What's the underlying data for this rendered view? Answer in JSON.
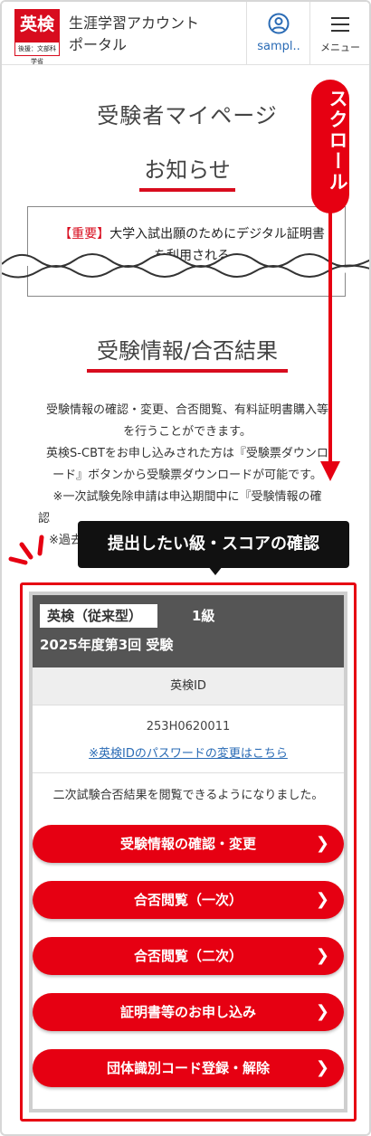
{
  "header": {
    "logo_text": "英検",
    "logo_subtext": "後援：文部科学省",
    "title_line1": "生涯学習アカウント",
    "title_line2": "ポータル",
    "user_label": "sampl..",
    "menu_label": "メニュー"
  },
  "page": {
    "title": "受験者マイページ"
  },
  "notices": {
    "heading": "お知らせ",
    "tag": "【重要】",
    "text_line1": "大学入試出願のためにデジタル証明書",
    "text_line2": "を利用される"
  },
  "exam_info": {
    "heading": "受験情報/合否結果",
    "desc_line1": "受験情報の確認・変更、合否閲覧、有料証明書購入等",
    "desc_line2": "を行うことができます。",
    "desc_line3": "英検S-CBTをお申し込みされた方は『受験票ダウンロ",
    "desc_line4": "ード』ボタンから受験票ダウンロードが可能です。",
    "desc_line5": "※一次試験免除申請は申込期間中に『受験情報の確",
    "desc_line6": "認",
    "desc_line7": "※過去"
  },
  "scroll_indicator": {
    "label": "スクロール"
  },
  "callout": {
    "text": "提出したい級・スコアの確認"
  },
  "card": {
    "exam_type": "英検（従来型）",
    "grade": "1級",
    "session": "2025年度第3回 受験",
    "id_label": "英検ID",
    "id_value": "253H0620011",
    "password_link": "※英検IDのパスワードの変更はこちら",
    "result_message": "二次試験合否結果を閲覧できるようになりました。",
    "buttons": [
      {
        "label": "受験情報の確認・変更"
      },
      {
        "label": "合否閲覧（一次）"
      },
      {
        "label": "合否閲覧（二次）"
      },
      {
        "label": "証明書等のお申し込み"
      },
      {
        "label": "団体識別コード登録・解除"
      }
    ]
  },
  "colors": {
    "brand_red": "#d80c1e",
    "button_red": "#e60012",
    "link_blue": "#2a6bb5",
    "card_header": "#555555"
  }
}
